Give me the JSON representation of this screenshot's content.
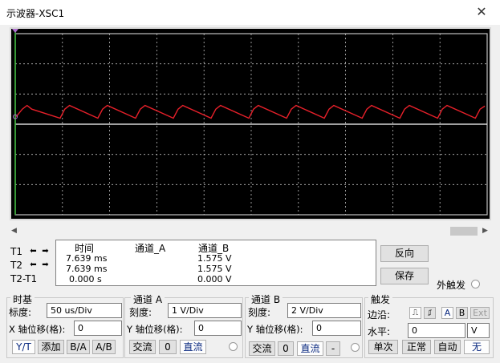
{
  "window": {
    "title": "示波器-XSC1",
    "close_glyph": "✕"
  },
  "readout": {
    "headers": {
      "time": "时间",
      "ch_a": "通道_A",
      "ch_b": "通道_B"
    },
    "rows": [
      {
        "label": "T1",
        "time": "7.639 ms",
        "ch_a": "",
        "ch_b": "1.575 V"
      },
      {
        "label": "T2",
        "time": "7.639 ms",
        "ch_a": "",
        "ch_b": "1.575 V"
      },
      {
        "label": "T2-T1",
        "time": "0.000 s",
        "ch_a": "",
        "ch_b": "0.000 V"
      }
    ]
  },
  "buttons": {
    "reverse": "反向",
    "save": "保存",
    "ext_trigger": "外触发"
  },
  "timebase": {
    "title": "时基",
    "scale_label": "标度:",
    "scale_value": "50 us/Div",
    "xpos_label": "X 轴位移(格):",
    "xpos_value": "0",
    "modes": [
      "Y/T",
      "添加",
      "B/A",
      "A/B"
    ]
  },
  "channel_a": {
    "title": "通道 A",
    "scale_label": "刻度:",
    "scale_value": "1  V/Div",
    "ypos_label": "Y 轴位移(格):",
    "ypos_value": "0",
    "coupling": [
      "交流",
      "0",
      "直流"
    ]
  },
  "channel_b": {
    "title": "通道 B",
    "scale_label": "刻度:",
    "scale_value": "2  V/Div",
    "ypos_label": "Y 轴位移(格):",
    "ypos_value": "0",
    "coupling": [
      "交流",
      "0",
      "直流",
      "-"
    ]
  },
  "trigger": {
    "title": "触发",
    "edge_label": "边沿:",
    "edge_buttons": [
      "A",
      "B",
      "Ext"
    ],
    "level_label": "水平:",
    "level_value": "0",
    "level_unit": "V",
    "modes": [
      "单次",
      "正常",
      "自动",
      "无"
    ]
  },
  "colors": {
    "trace_b": "#e8202a",
    "trace_a": "#ffffff",
    "grid": "#c0c0c0",
    "screen_bg": "#000000",
    "cursor": "#3cbd3c"
  },
  "chart_data": {
    "type": "line",
    "x_divisions": 10,
    "y_divisions": 6,
    "series": [
      {
        "name": "通道_A",
        "color": "#ffffff",
        "x": [
          0,
          10.0
        ],
        "y": [
          0,
          0
        ]
      },
      {
        "name": "通道_B",
        "color": "#e8202a",
        "x": [
          0.02,
          0.15,
          0.25,
          0.35,
          0.95,
          1.05,
          1.15,
          1.75,
          1.85,
          1.95,
          2.55,
          2.65,
          2.75,
          3.35,
          3.45,
          3.55,
          4.15,
          4.25,
          4.35,
          4.95,
          5.05,
          5.15,
          5.75,
          5.85,
          5.95,
          6.55,
          6.65,
          6.75,
          7.35,
          7.45,
          7.55,
          8.15,
          8.25,
          8.35,
          8.95,
          9.05,
          9.15,
          9.75,
          9.85,
          9.95
        ],
        "y": [
          0.25,
          0.5,
          0.62,
          0.5,
          0.2,
          0.5,
          0.62,
          0.2,
          0.5,
          0.62,
          0.2,
          0.5,
          0.62,
          0.2,
          0.5,
          0.62,
          0.2,
          0.5,
          0.62,
          0.2,
          0.5,
          0.62,
          0.2,
          0.5,
          0.62,
          0.2,
          0.5,
          0.62,
          0.2,
          0.5,
          0.62,
          0.2,
          0.5,
          0.62,
          0.2,
          0.5,
          0.62,
          0.2,
          0.5,
          0.6
        ]
      }
    ],
    "cursor_t1_div": 0,
    "grid": true
  }
}
